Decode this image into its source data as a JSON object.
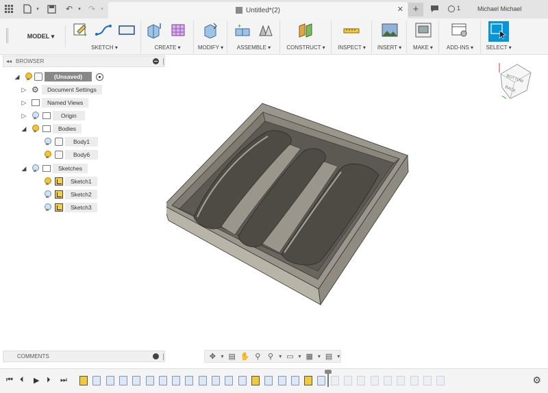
{
  "titlebar": {
    "doc_title": "Untitled*(2)",
    "jobs_count": "1",
    "user_name": "Michael Michael"
  },
  "toolbar": {
    "workspace": "MODEL",
    "groups": [
      {
        "label": "SKETCH"
      },
      {
        "label": "CREATE"
      },
      {
        "label": "MODIFY"
      },
      {
        "label": "ASSEMBLE"
      },
      {
        "label": "CONSTRUCT"
      },
      {
        "label": "INSPECT"
      },
      {
        "label": "INSERT"
      },
      {
        "label": "MAKE"
      },
      {
        "label": "ADD-INS"
      },
      {
        "label": "SELECT"
      }
    ]
  },
  "browser": {
    "title": "BROWSER",
    "root": "(Unsaved)",
    "items": [
      {
        "label": "Document Settings"
      },
      {
        "label": "Named Views"
      },
      {
        "label": "Origin"
      },
      {
        "label": "Bodies"
      },
      {
        "label": "Body1"
      },
      {
        "label": "Body6"
      },
      {
        "label": "Sketches"
      },
      {
        "label": "Sketch1"
      },
      {
        "label": "Sketch2"
      },
      {
        "label": "Sketch3"
      }
    ]
  },
  "comments": {
    "title": "COMMENTS"
  },
  "viewcube": {
    "faces": [
      "BOTTOM",
      "BACK"
    ]
  },
  "colors": {
    "accent": "#0696d7",
    "sketch_yellow": "#f1c93a",
    "model_face": "#858078",
    "model_side": "#a8a499"
  }
}
